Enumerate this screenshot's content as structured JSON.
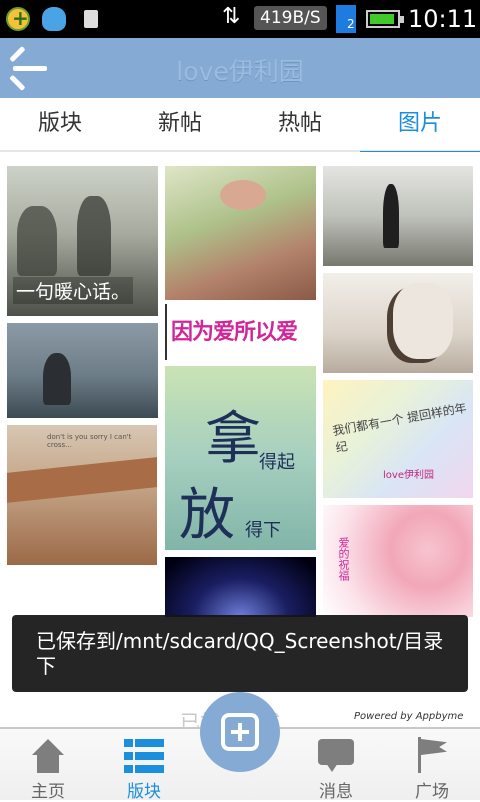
{
  "status_bar": {
    "app_icons": [
      "plus-app-icon",
      "qq-icon",
      "sd-card-icon"
    ],
    "net_speed": "419B/S",
    "time": "10:11",
    "battery_color": "#41c92b",
    "signal_color": "#1e7be0"
  },
  "header": {
    "title": "love伊利园",
    "back_icon": "back-arrow-icon",
    "bar_color": "#85aad3"
  },
  "tabs": [
    {
      "label": "版块"
    },
    {
      "label": "新帖"
    },
    {
      "label": "热帖"
    },
    {
      "label": "图片",
      "active": true
    }
  ],
  "gallery": {
    "captions": {
      "t1": "一句暖心话。",
      "t3": "don't is you sorry I can't cross...",
      "t5": "因为爱所以爱",
      "t6_a": "拿",
      "t6_b": "得起",
      "t6_c": "放",
      "t6_d": "得下",
      "t10_a": "我们都有一个 提回样的年纪",
      "t10_b": "love伊利园",
      "t11": "爱的祝福"
    }
  },
  "toast": {
    "message": "已保存到/mnt/sdcard/QQ_Screenshot/目录下"
  },
  "footer": {
    "loaded_text": "已加载完成",
    "powered_by": "Powered by Appbyme"
  },
  "bottom_nav": {
    "home": "主页",
    "boards": "版块",
    "messages": "消息",
    "square": "广场",
    "accent_color": "#1b8ede"
  }
}
